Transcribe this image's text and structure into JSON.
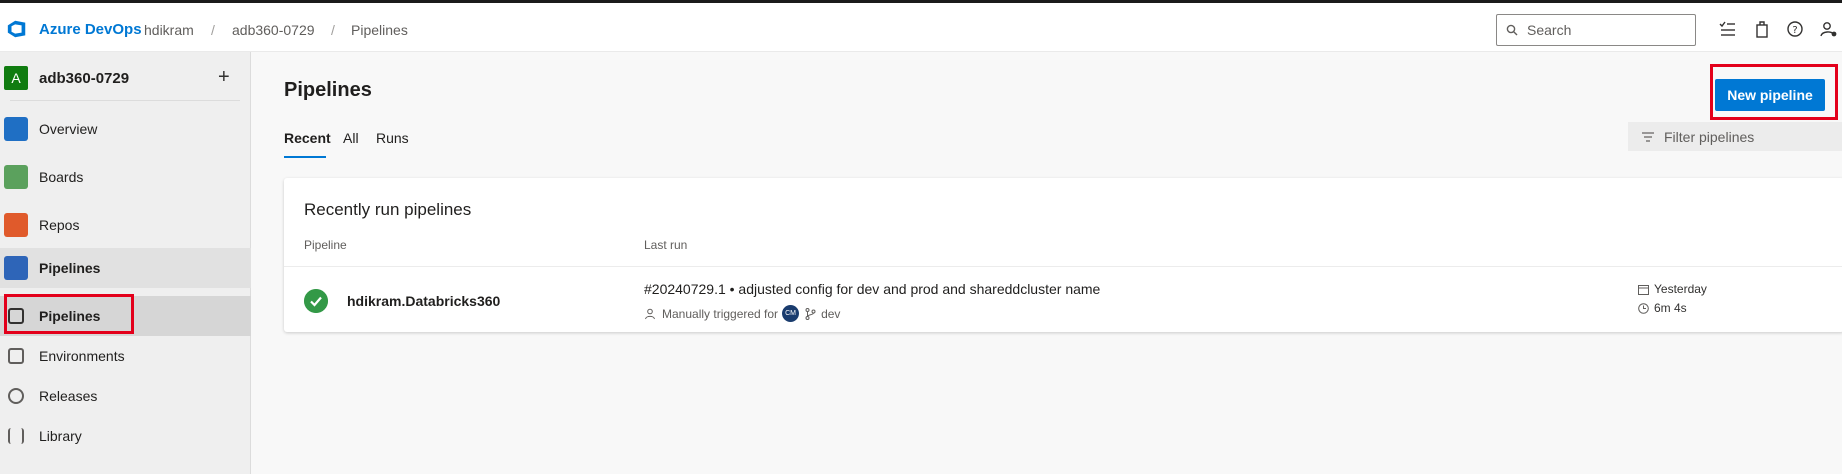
{
  "topbar": {
    "brand": "Azure DevOps",
    "breadcrumb": [
      "hdikram",
      "adb360-0729",
      "Pipelines"
    ],
    "separator": "/",
    "search_placeholder": "Search"
  },
  "sidebar": {
    "project_initial": "A",
    "project_name": "adb360-0729",
    "add_symbol": "+",
    "items": [
      {
        "label": "Overview",
        "icon": "overview-icon"
      },
      {
        "label": "Boards",
        "icon": "boards-icon"
      },
      {
        "label": "Repos",
        "icon": "repos-icon"
      },
      {
        "label": "Pipelines",
        "icon": "pipelines-icon"
      },
      {
        "label": "Pipelines",
        "icon": "pipelines-sub-icon"
      },
      {
        "label": "Environments",
        "icon": "environments-icon"
      },
      {
        "label": "Releases",
        "icon": "releases-icon"
      },
      {
        "label": "Library",
        "icon": "library-icon"
      }
    ]
  },
  "main": {
    "title": "Pipelines",
    "tabs": [
      "Recent",
      "All",
      "Runs"
    ],
    "new_button": "New pipeline",
    "filter_placeholder": "Filter pipelines",
    "card_title": "Recently run pipelines",
    "columns": [
      "Pipeline",
      "Last run"
    ],
    "rows": [
      {
        "name": "hdikram.Databricks360",
        "status": "succeeded",
        "run_title": "#20240729.1 • adjusted config for dev and prod and shareddcluster name",
        "trigger": "Manually triggered for",
        "avatar_initials": "CM",
        "branch": "dev",
        "when": "Yesterday",
        "duration": "6m 4s"
      }
    ]
  },
  "colors": {
    "accent": "#0078d4",
    "success": "#339947",
    "highlight": "#e3001b"
  }
}
